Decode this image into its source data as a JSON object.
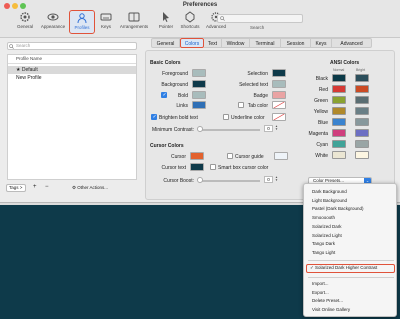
{
  "window": {
    "title": "Preferences"
  },
  "toolbar": {
    "items": [
      {
        "label": "General",
        "icon": "gear-icon"
      },
      {
        "label": "Appearance",
        "icon": "eye-icon"
      },
      {
        "label": "Profiles",
        "icon": "person-icon"
      },
      {
        "label": "Keys",
        "icon": "keyboard-icon"
      },
      {
        "label": "Arrangements",
        "icon": "window-arrangement-icon"
      },
      {
        "label": "Pointer",
        "icon": "pointer-icon"
      },
      {
        "label": "Shortcuts",
        "icon": "shortcuts-icon"
      },
      {
        "label": "Advanced",
        "icon": "advanced-gear-icon"
      }
    ],
    "search_label": "Search"
  },
  "profiles": {
    "search_placeholder": "Search",
    "column_header": "Profile Name",
    "rows": [
      "★ Default",
      "New Profile"
    ],
    "tags_label": "Tags >",
    "other_actions": "Other Actions..."
  },
  "tabs": [
    "General",
    "Colors",
    "Text",
    "Window",
    "Terminal",
    "Session",
    "Keys",
    "Advanced"
  ],
  "basic_colors": {
    "heading": "Basic Colors",
    "foreground": "Foreground",
    "background": "Background",
    "bold": "Bold",
    "links": "Links",
    "selection": "Selection",
    "selected_text": "Selected text",
    "badge": "Badge",
    "tab_color": "Tab color",
    "brighten_bold": "Brighten bold text",
    "underline_color": "Underline color",
    "min_contrast": "Minimum Contrast:",
    "min_contrast_value": "0"
  },
  "cursor_colors": {
    "heading": "Cursor Colors",
    "cursor": "Cursor",
    "cursor_text": "Cursor text",
    "cursor_guide": "Cursor guide",
    "smart_box": "Smart box cursor color",
    "cursor_boost": "Cursor Boost:",
    "cursor_boost_value": "0"
  },
  "ansi": {
    "heading": "ANSI Colors",
    "normal": "Normal",
    "bright": "Bright",
    "rows": [
      "Black",
      "Red",
      "Green",
      "Yellow",
      "Blue",
      "Magenta",
      "Cyan",
      "White"
    ],
    "normal_colors": [
      "#0a3947",
      "#d53a35",
      "#8aa231",
      "#b0892b",
      "#3a83cf",
      "#cf3f7e",
      "#40a398",
      "#ebe6d3"
    ],
    "bright_colors": [
      "#2b4e5b",
      "#cb4b24",
      "#5a6d72",
      "#6a7f86",
      "#87989c",
      "#6c6fc3",
      "#99a5a5",
      "#fdf6e2"
    ]
  },
  "swatches": {
    "foreground": "#a8bcbc",
    "background": "#0e3a4a",
    "bold": "#a8bcbc",
    "links": "#2f6fb5",
    "selection": "#0e3a4a",
    "selected_text": "#a8bcbc",
    "badge": "#e9a3a3",
    "cursor": "#e2622e",
    "cursor_text": "#0e3a4a"
  },
  "preset_button": "Color Presets...",
  "menu": {
    "presets": [
      "Dark Background",
      "Light Background",
      "Pastel (Dark Background)",
      "Smoooooth",
      "Solarized Dark",
      "Solarized Light",
      "Tango Dark",
      "Tango Light"
    ],
    "selected": "✓ Solarized Dark Higher Contrast",
    "actions": [
      "Import...",
      "Export...",
      "Delete Preset...",
      "Visit Online Gallery"
    ]
  }
}
